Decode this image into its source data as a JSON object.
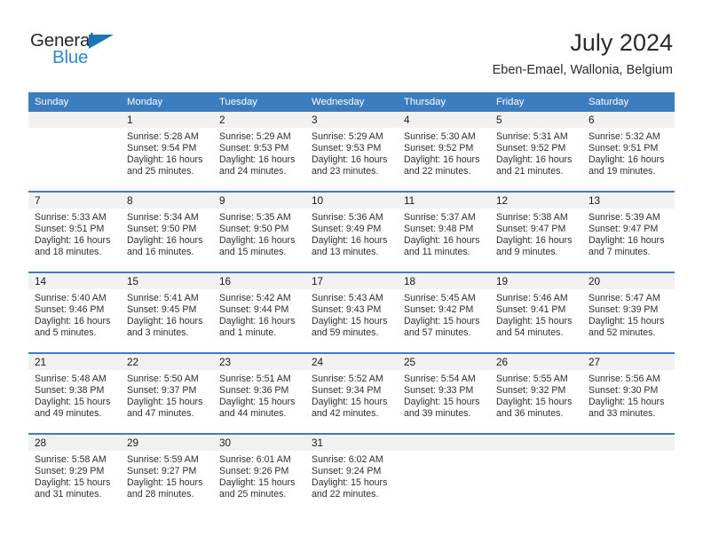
{
  "brand": {
    "name_part1": "General",
    "name_part2": "Blue",
    "accent_color": "#2b8ad6",
    "triangle_color": "#1b75bb"
  },
  "header": {
    "title": "July 2024",
    "subtitle": "Eben-Emael, Wallonia, Belgium"
  },
  "calendar": {
    "header_bg": "#3c7dc0",
    "daynum_bg": "#f1f1f1",
    "weekday_labels": [
      "Sunday",
      "Monday",
      "Tuesday",
      "Wednesday",
      "Thursday",
      "Friday",
      "Saturday"
    ],
    "weeks": [
      [
        {
          "day": "",
          "lines": []
        },
        {
          "day": "1",
          "lines": [
            "Sunrise: 5:28 AM",
            "Sunset: 9:54 PM",
            "Daylight: 16 hours",
            "and 25 minutes."
          ]
        },
        {
          "day": "2",
          "lines": [
            "Sunrise: 5:29 AM",
            "Sunset: 9:53 PM",
            "Daylight: 16 hours",
            "and 24 minutes."
          ]
        },
        {
          "day": "3",
          "lines": [
            "Sunrise: 5:29 AM",
            "Sunset: 9:53 PM",
            "Daylight: 16 hours",
            "and 23 minutes."
          ]
        },
        {
          "day": "4",
          "lines": [
            "Sunrise: 5:30 AM",
            "Sunset: 9:52 PM",
            "Daylight: 16 hours",
            "and 22 minutes."
          ]
        },
        {
          "day": "5",
          "lines": [
            "Sunrise: 5:31 AM",
            "Sunset: 9:52 PM",
            "Daylight: 16 hours",
            "and 21 minutes."
          ]
        },
        {
          "day": "6",
          "lines": [
            "Sunrise: 5:32 AM",
            "Sunset: 9:51 PM",
            "Daylight: 16 hours",
            "and 19 minutes."
          ]
        }
      ],
      [
        {
          "day": "7",
          "lines": [
            "Sunrise: 5:33 AM",
            "Sunset: 9:51 PM",
            "Daylight: 16 hours",
            "and 18 minutes."
          ]
        },
        {
          "day": "8",
          "lines": [
            "Sunrise: 5:34 AM",
            "Sunset: 9:50 PM",
            "Daylight: 16 hours",
            "and 16 minutes."
          ]
        },
        {
          "day": "9",
          "lines": [
            "Sunrise: 5:35 AM",
            "Sunset: 9:50 PM",
            "Daylight: 16 hours",
            "and 15 minutes."
          ]
        },
        {
          "day": "10",
          "lines": [
            "Sunrise: 5:36 AM",
            "Sunset: 9:49 PM",
            "Daylight: 16 hours",
            "and 13 minutes."
          ]
        },
        {
          "day": "11",
          "lines": [
            "Sunrise: 5:37 AM",
            "Sunset: 9:48 PM",
            "Daylight: 16 hours",
            "and 11 minutes."
          ]
        },
        {
          "day": "12",
          "lines": [
            "Sunrise: 5:38 AM",
            "Sunset: 9:47 PM",
            "Daylight: 16 hours",
            "and 9 minutes."
          ]
        },
        {
          "day": "13",
          "lines": [
            "Sunrise: 5:39 AM",
            "Sunset: 9:47 PM",
            "Daylight: 16 hours",
            "and 7 minutes."
          ]
        }
      ],
      [
        {
          "day": "14",
          "lines": [
            "Sunrise: 5:40 AM",
            "Sunset: 9:46 PM",
            "Daylight: 16 hours",
            "and 5 minutes."
          ]
        },
        {
          "day": "15",
          "lines": [
            "Sunrise: 5:41 AM",
            "Sunset: 9:45 PM",
            "Daylight: 16 hours",
            "and 3 minutes."
          ]
        },
        {
          "day": "16",
          "lines": [
            "Sunrise: 5:42 AM",
            "Sunset: 9:44 PM",
            "Daylight: 16 hours",
            "and 1 minute."
          ]
        },
        {
          "day": "17",
          "lines": [
            "Sunrise: 5:43 AM",
            "Sunset: 9:43 PM",
            "Daylight: 15 hours",
            "and 59 minutes."
          ]
        },
        {
          "day": "18",
          "lines": [
            "Sunrise: 5:45 AM",
            "Sunset: 9:42 PM",
            "Daylight: 15 hours",
            "and 57 minutes."
          ]
        },
        {
          "day": "19",
          "lines": [
            "Sunrise: 5:46 AM",
            "Sunset: 9:41 PM",
            "Daylight: 15 hours",
            "and 54 minutes."
          ]
        },
        {
          "day": "20",
          "lines": [
            "Sunrise: 5:47 AM",
            "Sunset: 9:39 PM",
            "Daylight: 15 hours",
            "and 52 minutes."
          ]
        }
      ],
      [
        {
          "day": "21",
          "lines": [
            "Sunrise: 5:48 AM",
            "Sunset: 9:38 PM",
            "Daylight: 15 hours",
            "and 49 minutes."
          ]
        },
        {
          "day": "22",
          "lines": [
            "Sunrise: 5:50 AM",
            "Sunset: 9:37 PM",
            "Daylight: 15 hours",
            "and 47 minutes."
          ]
        },
        {
          "day": "23",
          "lines": [
            "Sunrise: 5:51 AM",
            "Sunset: 9:36 PM",
            "Daylight: 15 hours",
            "and 44 minutes."
          ]
        },
        {
          "day": "24",
          "lines": [
            "Sunrise: 5:52 AM",
            "Sunset: 9:34 PM",
            "Daylight: 15 hours",
            "and 42 minutes."
          ]
        },
        {
          "day": "25",
          "lines": [
            "Sunrise: 5:54 AM",
            "Sunset: 9:33 PM",
            "Daylight: 15 hours",
            "and 39 minutes."
          ]
        },
        {
          "day": "26",
          "lines": [
            "Sunrise: 5:55 AM",
            "Sunset: 9:32 PM",
            "Daylight: 15 hours",
            "and 36 minutes."
          ]
        },
        {
          "day": "27",
          "lines": [
            "Sunrise: 5:56 AM",
            "Sunset: 9:30 PM",
            "Daylight: 15 hours",
            "and 33 minutes."
          ]
        }
      ],
      [
        {
          "day": "28",
          "lines": [
            "Sunrise: 5:58 AM",
            "Sunset: 9:29 PM",
            "Daylight: 15 hours",
            "and 31 minutes."
          ]
        },
        {
          "day": "29",
          "lines": [
            "Sunrise: 5:59 AM",
            "Sunset: 9:27 PM",
            "Daylight: 15 hours",
            "and 28 minutes."
          ]
        },
        {
          "day": "30",
          "lines": [
            "Sunrise: 6:01 AM",
            "Sunset: 9:26 PM",
            "Daylight: 15 hours",
            "and 25 minutes."
          ]
        },
        {
          "day": "31",
          "lines": [
            "Sunrise: 6:02 AM",
            "Sunset: 9:24 PM",
            "Daylight: 15 hours",
            "and 22 minutes."
          ]
        },
        {
          "day": "",
          "lines": []
        },
        {
          "day": "",
          "lines": []
        },
        {
          "day": "",
          "lines": []
        }
      ]
    ]
  }
}
